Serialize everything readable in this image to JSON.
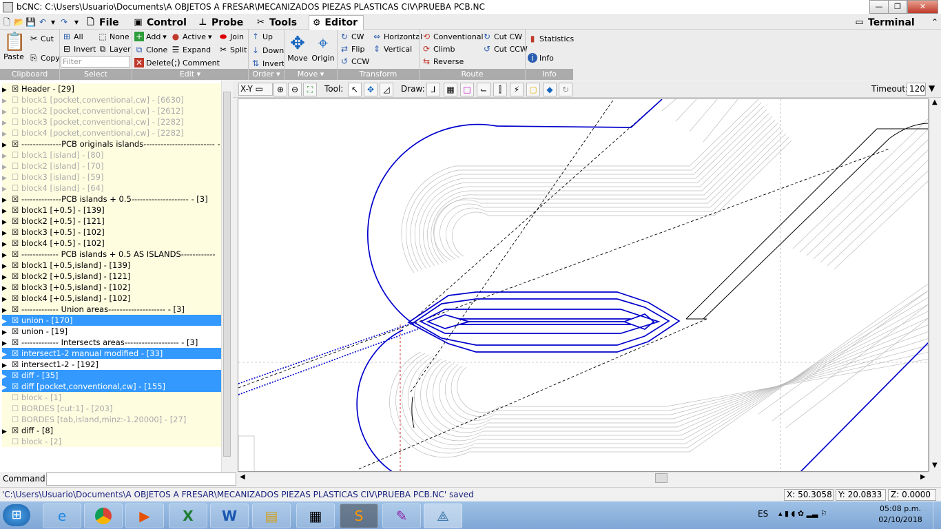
{
  "window": {
    "title": "bCNC: C:\\Users\\Usuario\\Documents\\A OBJETOS A FRESAR\\MECANIZADOS PIEZAS PLASTICAS CIV\\PRUEBA PCB.NC",
    "minimize": "—",
    "maximize": "❐",
    "close": "✕"
  },
  "tabs": [
    {
      "label": "File",
      "icon": "file-icon"
    },
    {
      "label": "Control",
      "icon": "control-icon"
    },
    {
      "label": "Probe",
      "icon": "probe-icon"
    },
    {
      "label": "Tools",
      "icon": "tools-icon"
    },
    {
      "label": "Editor",
      "icon": "editor-icon"
    }
  ],
  "terminal_tab": "Terminal",
  "ribbon": {
    "clipboard": {
      "paste": "Paste",
      "cut": "Cut",
      "copy": "Copy",
      "group": "Clipboard"
    },
    "select": {
      "all": "All",
      "none": "None",
      "invert": "Invert",
      "layer": "Layer",
      "filter_placeholder": "Filter",
      "group": "Select"
    },
    "edit": {
      "add": "Add",
      "active": "Active",
      "join": "Join",
      "clone": "Clone",
      "expand": "Expand",
      "split": "Split",
      "delete": "Delete",
      "comment": "Comment",
      "group": "Edit"
    },
    "order": {
      "up": "Up",
      "down": "Down",
      "invert": "Invert",
      "group": "Order"
    },
    "move": {
      "move": "Move",
      "origin": "Origin",
      "group": "Move"
    },
    "transform": {
      "cw": "CW",
      "horizontal": "Horizontal",
      "flip": "Flip",
      "vertical": "Vertical",
      "ccw": "CCW",
      "group": "Transform"
    },
    "route": {
      "conventional": "Conventional",
      "cut_cw": "Cut CW",
      "climb": "Climb",
      "cut_ccw": "Cut CCW",
      "reverse": "Reverse",
      "group": "Route"
    },
    "info": {
      "statistics": "Statistics",
      "info": "Info",
      "group": "Info"
    }
  },
  "tree": [
    {
      "text": "Header - [29]",
      "state": "header-row",
      "arrow": true
    },
    {
      "text": "block1 [pocket,conventional,cw] - [6630]",
      "state": "disabled",
      "arrow": true
    },
    {
      "text": "block2 [pocket,conventional,cw] - [2612]",
      "state": "disabled",
      "arrow": true
    },
    {
      "text": "block3 [pocket,conventional,cw] - [2282]",
      "state": "disabled",
      "arrow": true
    },
    {
      "text": "block4 [pocket,conventional,cw] - [2282]",
      "state": "disabled",
      "arrow": true
    },
    {
      "text": "--------------PCB originals islands------------------------- - [",
      "state": "active",
      "arrow": true
    },
    {
      "text": "block1 [island] - [80]",
      "state": "disabled",
      "arrow": true
    },
    {
      "text": "block2 [island] - [70]",
      "state": "disabled",
      "arrow": true
    },
    {
      "text": "block3 [island] - [59]",
      "state": "disabled",
      "arrow": true
    },
    {
      "text": "block4 [island] - [64]",
      "state": "disabled",
      "arrow": true
    },
    {
      "text": "--------------PCB islands + 0.5-------------------- - [3]",
      "state": "active",
      "arrow": true
    },
    {
      "text": "block1 [+0.5] - [139]",
      "state": "active",
      "arrow": true
    },
    {
      "text": "block2 [+0.5] - [121]",
      "state": "active",
      "arrow": true
    },
    {
      "text": "block3 [+0.5] - [102]",
      "state": "active",
      "arrow": true
    },
    {
      "text": "block4 [+0.5] - [102]",
      "state": "active",
      "arrow": true
    },
    {
      "text": "------------- PCB islands + 0.5 AS ISLANDS------------",
      "state": "active",
      "arrow": true
    },
    {
      "text": "block1 [+0.5,island] - [139]",
      "state": "active",
      "arrow": true
    },
    {
      "text": "block2 [+0.5,island] - [121]",
      "state": "active",
      "arrow": true
    },
    {
      "text": "block3 [+0.5,island] - [102]",
      "state": "active",
      "arrow": true
    },
    {
      "text": "block4 [+0.5,island] - [102]",
      "state": "active",
      "arrow": true
    },
    {
      "text": "------------- Union areas-------------------- - [3]",
      "state": "active",
      "arrow": true
    },
    {
      "text": "union - [170]",
      "state": "selected",
      "arrow": true
    },
    {
      "text": "union - [19]",
      "state": "plain",
      "arrow": true
    },
    {
      "text": "------------- Intersects areas------------------- - [3]",
      "state": "plain",
      "arrow": true
    },
    {
      "text": "intersect1-2 manual modified - [33]",
      "state": "selected",
      "arrow": true
    },
    {
      "text": "intersect1-2 - [192]",
      "state": "plain",
      "arrow": true
    },
    {
      "text": "diff - [35]",
      "state": "selected",
      "arrow": true
    },
    {
      "text": "diff [pocket,conventional,cw] - [155]",
      "state": "selected",
      "arrow": true
    },
    {
      "text": "block - [1]",
      "state": "disabled",
      "arrow": false
    },
    {
      "text": "BORDES [cut:1] - [203]",
      "state": "disabled",
      "arrow": false
    },
    {
      "text": "BORDES [tab,island,minz:-1.20000] - [27]",
      "state": "disabled",
      "arrow": false
    },
    {
      "text": "diff - [8]",
      "state": "active",
      "arrow": true
    },
    {
      "text": "block - [2]",
      "state": "disabled",
      "arrow": false
    }
  ],
  "command_label": "Command:",
  "canvas_toolbar": {
    "view": "X-Y",
    "tool_label": "Tool:",
    "draw_label": "Draw:",
    "timeout_label": "Timeout:",
    "timeout_value": "120"
  },
  "status": {
    "message": "'C:\\Users\\Usuario\\Documents\\A OBJETOS A FRESAR\\MECANIZADOS PIEZAS PLASTICAS CIV\\PRUEBA PCB.NC' saved",
    "x": "X: 50.3058",
    "y": "Y: 20.0833",
    "z": "Z: 0.0000"
  },
  "taskbar": {
    "lang": "ES",
    "time": "05:08 p.m.",
    "date": "02/10/2018"
  }
}
